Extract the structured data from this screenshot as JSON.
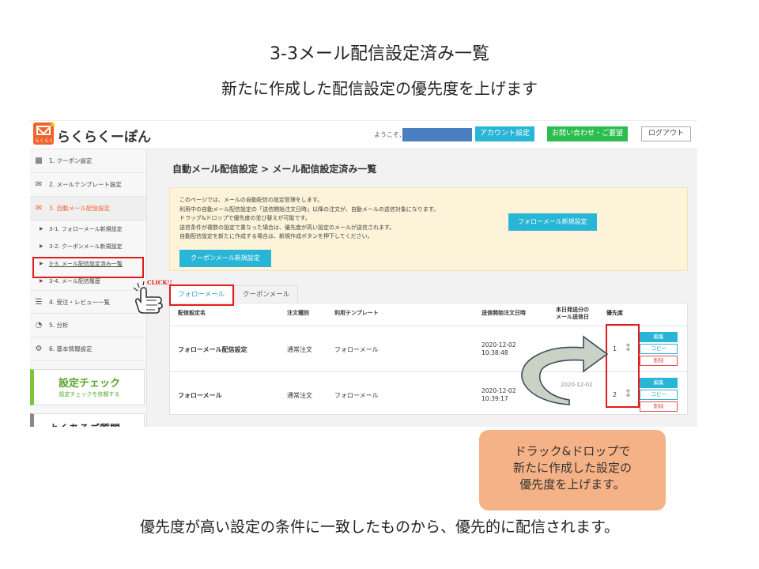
{
  "slide": {
    "title": "3-3メール配信設定済み一覧",
    "subtitle": "新たに作成した配信設定の優先度を上げます",
    "footer": "優先度が高い設定の条件に一致したものから、優先的に配信されます。",
    "callout": [
      "ドラック&ドロップで",
      "新たに作成した設定の",
      "優先度を上げます。"
    ],
    "click_label": "CLICK!!"
  },
  "header": {
    "logo_text": "らくらくーぽん",
    "logo_small": "らくらく",
    "welcome": "ようこそ、",
    "account_button": "アカウント設定",
    "contact_button": "お問い合わせ・ご要望",
    "logout_button": "ログアウト"
  },
  "sidebar": {
    "items": [
      {
        "label": "1. クーポン設定",
        "icon": "qr-icon"
      },
      {
        "label": "2. メールテンプレート設定",
        "icon": "envelope-icon"
      },
      {
        "label": "3. 自動メール配信設定",
        "icon": "mail-gear-icon"
      }
    ],
    "subitems": [
      "3-1. フォローメール新規設定",
      "3-2. クーポンメール新規設定",
      "3-3. メール配信設定済み一覧",
      "3-4. メール配信履歴"
    ],
    "items_after": [
      {
        "label": "4. 受注・レビュー一覧",
        "icon": "list-icon"
      },
      {
        "label": "5. 分析",
        "icon": "pie-chart-icon"
      },
      {
        "label": "6. 基本情報設定",
        "icon": "gear-icon"
      }
    ],
    "check_title": "設定チェック",
    "check_sub": "設定チェックを依頼する",
    "next_text": "よくあるご質問"
  },
  "main": {
    "breadcrumb": "自動メール配信設定 > メール配信設定済み一覧",
    "info_lines": [
      "このページでは、メールの自動配信の設定管理をします。",
      "利用中の自動メール配信設定の「送信開始注文日時」以降の注文が、自動メールの送信対象になります。",
      "ドラッグ&ドロップで優先度の並び替えが可能です。",
      "送信条件が複数の設定で重なった場合は、優先度が高い設定のメールが送信されます。",
      "自動配信設定を新たに作成する場合は、新規作成ボタンを押下してください。"
    ],
    "follow_new_button": "フォローメール新規設定",
    "coupon_new_button": "クーポンメール新規設定",
    "tabs": [
      "フォローメール",
      "クーポンメール"
    ],
    "table": {
      "headers": [
        "配信設定名",
        "注文種別",
        "利用テンプレート",
        "送信開始注文日時",
        "本日発送分の",
        "メール送信日",
        "優先度"
      ],
      "rows": [
        {
          "name": "フォローメール配信設定",
          "type": "通常注文",
          "template": "フォローメール",
          "date": "2020-12-02",
          "time": "10:38:48",
          "priority": "1"
        },
        {
          "name": "フォローメール",
          "type": "通常注文",
          "template": "フォローメール",
          "date": "2020-12-02",
          "time": "10:39:17",
          "priority": "2",
          "send_date_partial": "2020-12-02"
        }
      ],
      "edit_label": "編集",
      "copy_label": "コピー",
      "delete_label": "削除"
    }
  },
  "colors": {
    "accent": "#29b6d6",
    "brand_orange": "#f0632b",
    "highlight_red": "#e21b1b",
    "callout": "#f6b287",
    "green": "#2cbd4f"
  }
}
